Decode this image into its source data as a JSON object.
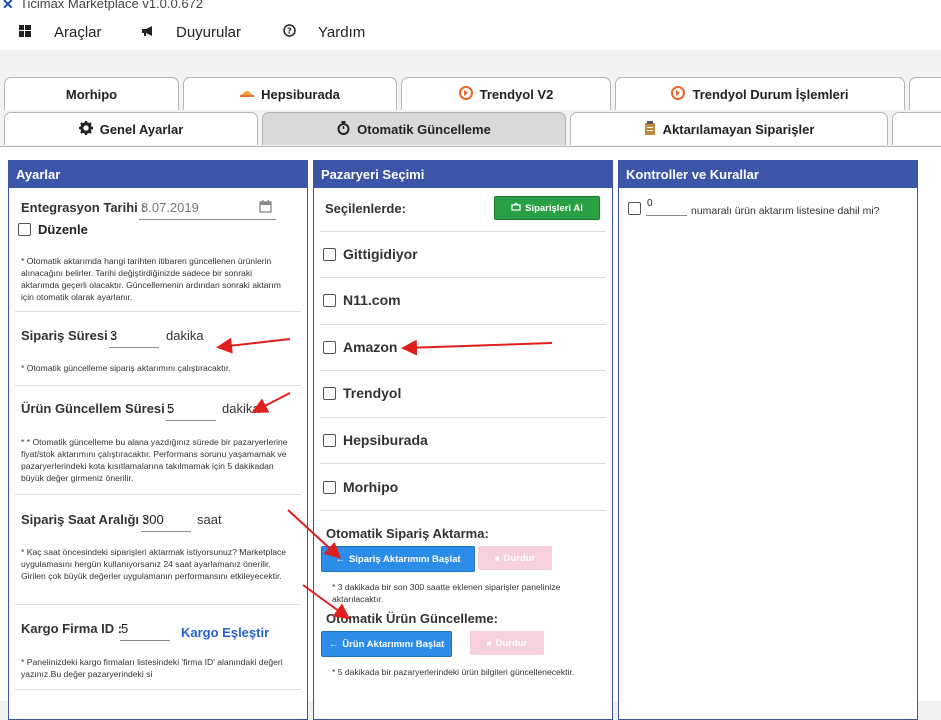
{
  "window": {
    "title": "Ticimax Marketplace v1.0.0.672"
  },
  "menu": [
    {
      "icon": "windows-icon",
      "label": "Araçlar"
    },
    {
      "icon": "megaphone-icon",
      "label": "Duyurular"
    },
    {
      "icon": "help-icon",
      "label": "Yardım"
    }
  ],
  "tabs_row1": [
    "Morhipo",
    "Hepsiburada",
    "Trendyol V2",
    "Trendyol Durum İşlemleri"
  ],
  "tabs_row2": [
    "Genel Ayarlar",
    "Otomatik Güncelleme",
    "Aktarılamayan Siparişler"
  ],
  "active_tab": "Otomatik Güncelleme",
  "settings": {
    "header": "Ayarlar",
    "integration_date_label": "Entegrasyon Tarihi :",
    "integration_date_value": "8.07.2019",
    "edit_label": "Düzenle",
    "note1": "* Otomatik aktarımda hangi tarihten itibaren güncellenen ürünlerin alınacağını belirler. Tarihi değiştirdiğinizde sadece bir sonraki aktarımda geçerli olacaktır. Güncellemenin ardından sonraki aktarım için otomatik olarak ayarlanır.",
    "order_period_label": "Sipariş Süresi :",
    "order_period_value": "3",
    "order_period_unit": "dakika",
    "note2": "* Otomatik güncelleme sipariş aktarımını çalıştıracaktır.",
    "product_update_label": "Ürün Güncellem Süresi :",
    "product_update_value": "5",
    "product_update_unit": "dakika",
    "note3": "* * Otomatik güncelleme bu alana yazdığınız sürede bir pazaryerlerine fiyat/stok aktarımını çalıştıracaktır. Performans sorunu yaşamamak ve pazaryerlerindeki kota kısıtlamalarına takılmamak için 5 dakikadan büyük değer girmeniz önerilir.",
    "order_hour_label": "Sipariş Saat Aralığı :",
    "order_hour_value": "300",
    "order_hour_unit": "saat",
    "note4": "* Kaç saat öncesindeki siparişleri aktarmak istiyorsunuz? Marketplace uygulamasını hergün kullanıyorsanız 24 saat ayarlamanız önerilir. Girilen çok büyük değerler uygulamanın performansını etkileyecektir.",
    "cargo_label": "Kargo Firma ID :",
    "cargo_value": "5",
    "cargo_link": "Kargo Eşleştir",
    "note5": "* Panelinizdeki kargo firmaları listesindeki 'firma ID' alanındaki değeri yazınız.Bu değer pazaryerindeki si"
  },
  "marketplace": {
    "header": "Pazaryeri Seçimi",
    "selected_label": "Seçilenlerde:",
    "get_orders_button": "Siparişleri Al",
    "items": [
      "Gittigidiyor",
      "N11.com",
      "Amazon",
      "Trendyol",
      "Hepsiburada",
      "Morhipo"
    ],
    "auto_order_title": "Otomatik Sipariş Aktarma:",
    "start_order_button": "Sipariş Aktarımını Başlat",
    "stop_button": "Durdur",
    "order_note": "* 3 dakikada bir son 300 saatte eklenen siparişler panelinize aktarılacaktır.",
    "auto_product_title": "Otomatik Ürün Güncelleme:",
    "start_product_button": "Ürün Aktarımını Başlat",
    "product_note": "* 5 dakikada bir pazaryerlerindeki ürün bilgileri güncellenecektir."
  },
  "controls": {
    "header": "Kontroller ve Kurallar",
    "rule_value": "0",
    "rule_text": "numaralı ürün aktarım listesine dahil mi?"
  },
  "colors": {
    "panel_header": "#3d55a8",
    "link": "#2563c9",
    "start_button": "#2c8de8",
    "stop_button": "#f7d0dd",
    "get_orders_button": "#2aa044",
    "arrow": "#e01e1e"
  }
}
